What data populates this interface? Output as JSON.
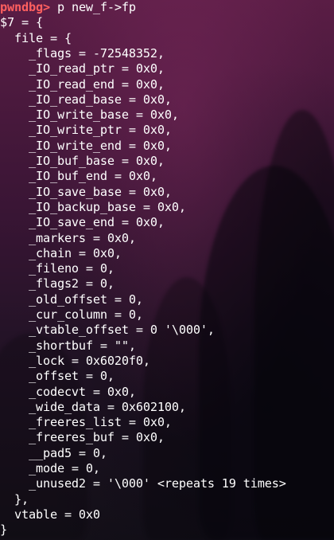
{
  "terminal": {
    "prompt": "pwndbg>",
    "command": " p new_f->fp",
    "output_lines": [
      "$7 = {",
      "  file = {",
      "    _flags = -72548352,",
      "    _IO_read_ptr = 0x0,",
      "    _IO_read_end = 0x0,",
      "    _IO_read_base = 0x0,",
      "    _IO_write_base = 0x0,",
      "    _IO_write_ptr = 0x0,",
      "    _IO_write_end = 0x0,",
      "    _IO_buf_base = 0x0,",
      "    _IO_buf_end = 0x0,",
      "    _IO_save_base = 0x0,",
      "    _IO_backup_base = 0x0,",
      "    _IO_save_end = 0x0,",
      "    _markers = 0x0,",
      "    _chain = 0x0,",
      "    _fileno = 0,",
      "    _flags2 = 0,",
      "    _old_offset = 0,",
      "    _cur_column = 0,",
      "    _vtable_offset = 0 '\\000',",
      "    _shortbuf = \"\",",
      "    _lock = 0x6020f0,",
      "    _offset = 0,",
      "    _codecvt = 0x0,",
      "    _wide_data = 0x602100,",
      "    _freeres_list = 0x0,",
      "    _freeres_buf = 0x0,",
      "    __pad5 = 0,",
      "    _mode = 0,",
      "    _unused2 = '\\000' <repeats 19 times>",
      "  },",
      "  vtable = 0x0",
      "}"
    ]
  },
  "colors": {
    "prompt": "#ff5f5f",
    "text": "#ffffff",
    "background": "#3a1230"
  }
}
